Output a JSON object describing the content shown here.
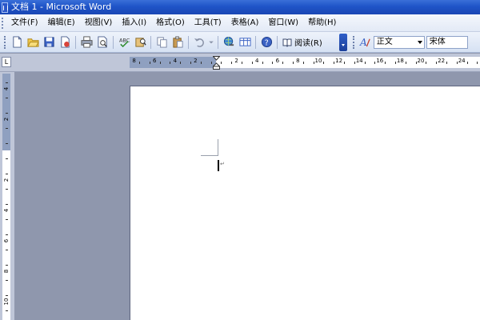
{
  "window": {
    "title": "文档 1 - Microsoft Word"
  },
  "menu": {
    "items": [
      {
        "label": "文件(F)"
      },
      {
        "label": "编辑(E)"
      },
      {
        "label": "视图(V)"
      },
      {
        "label": "插入(I)"
      },
      {
        "label": "格式(O)"
      },
      {
        "label": "工具(T)"
      },
      {
        "label": "表格(A)"
      },
      {
        "label": "窗口(W)"
      },
      {
        "label": "帮助(H)"
      }
    ]
  },
  "toolbar": {
    "read_label": "阅读(R)",
    "style_value": "正文",
    "font_value": "宋体",
    "icons": [
      "new-document-icon",
      "open-folder-icon",
      "save-icon",
      "permission-icon",
      "print-icon",
      "print-preview-icon",
      "spelling-icon",
      "research-icon",
      "copy-icon",
      "paste-icon",
      "undo-icon",
      "undo-dropdown-icon",
      "insert-hyperlink-icon",
      "tables-borders-icon",
      "help-icon",
      "read-icon",
      "styles-formatting-icon"
    ]
  },
  "ruler": {
    "tab_selector": "L",
    "horizontal_numbers": [
      "8",
      "6",
      "4",
      "2",
      "2",
      "4",
      "6",
      "8",
      "10",
      "12",
      "14",
      "16",
      "18",
      "20",
      "22",
      "24"
    ],
    "vertical_numbers": [
      "4",
      "2",
      "2",
      "4",
      "6",
      "8",
      "10"
    ]
  },
  "document": {
    "paragraph_mark": "↵"
  },
  "colors": {
    "titlebar": "#1f54c8",
    "workspace": "#8f97ad",
    "ruler_margin": "#8fa0c0",
    "page": "#ffffff"
  }
}
